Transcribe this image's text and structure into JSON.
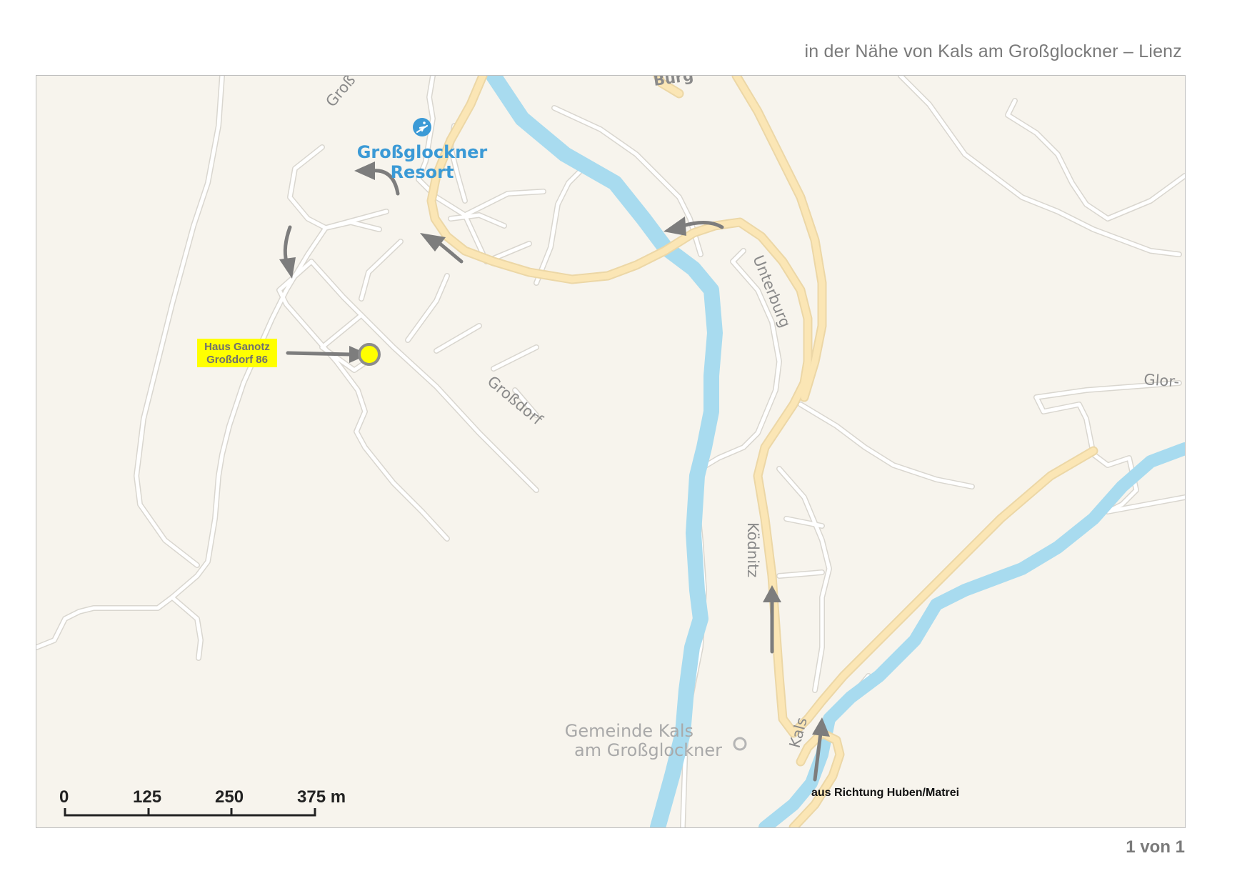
{
  "header": {
    "location_text": "in der Nähe von Kals am Großglockner – Lienz"
  },
  "footer": {
    "page_text": "1 von 1"
  },
  "map": {
    "streets": {
      "grossdorf": "Großdorf",
      "gross_top": "Groß",
      "burg": "Burg",
      "unterburg": "Unterburg",
      "koednitz": "Ködnitz",
      "kals": "Kals",
      "glor": "Glor-"
    },
    "poi": {
      "icon": "ski-icon",
      "line1": "Großglockner",
      "line2": "Resort",
      "color": "#3b9ad6"
    },
    "place": {
      "line1": "Gemeinde Kals",
      "line2": "am Großglockner"
    },
    "destination": {
      "line1": "Haus Ganotz",
      "line2": "Großdorf 86",
      "highlight_color": "#ffff00"
    },
    "direction_label": "aus Richtung Huben/Matrei",
    "scale_bar": {
      "labels": [
        "0",
        "125",
        "250",
        "375 m"
      ]
    },
    "colors": {
      "land": "#f7f4ed",
      "river": "#a8dbef",
      "main_road": "#fbe3ad",
      "minor_road": "#ffffff",
      "arrow": "#7d7d7d"
    }
  }
}
